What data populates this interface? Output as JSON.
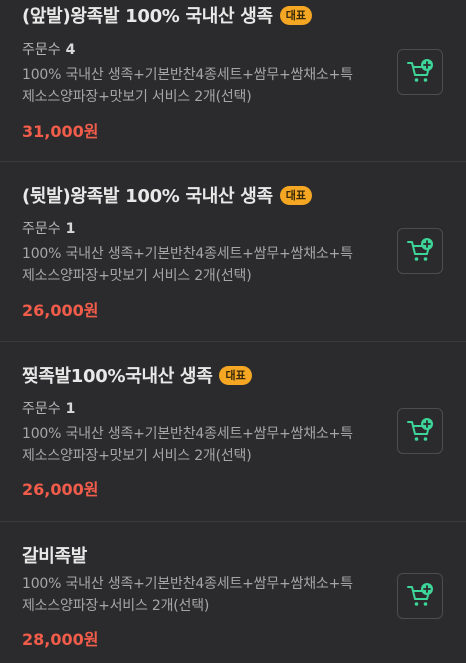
{
  "colors": {
    "background": "#2b2b2d",
    "price": "#f25c4a",
    "badge": "#f5a623",
    "cart_icon": "#3dd598"
  },
  "items": [
    {
      "name": "(앞발)왕족발 100% 국내산 생족",
      "badge": "대표",
      "order_label": "주문수",
      "order_count": "4",
      "desc_line1": "100% 국내산 생족+기본반찬4종세트+쌈무+쌈채소+특",
      "desc_line2": "제소스양파장+맛보기 서비스 2개(선택)",
      "price": "31,000원",
      "cart_icon": "cart-add-icon"
    },
    {
      "name": "(뒷발)왕족발 100% 국내산 생족",
      "badge": "대표",
      "order_label": "주문수",
      "order_count": "1",
      "desc_line1": "100% 국내산 생족+기본반찬4종세트+쌈무+쌈채소+특",
      "desc_line2": "제소스양파장+맛보기 서비스 2개(선택)",
      "price": "26,000원",
      "cart_icon": "cart-add-icon"
    },
    {
      "name": "찢족발100%국내산 생족",
      "badge": "대표",
      "order_label": "주문수",
      "order_count": "1",
      "desc_line1": "100% 국내산 생족+기본반찬4종세트+쌈무+쌈채소+특",
      "desc_line2": "제소스양파장+맛보기 서비스 2개(선택)",
      "price": "26,000원",
      "cart_icon": "cart-add-icon"
    },
    {
      "name": "갈비족발",
      "desc_line1": "100% 국내산 생족+기본반찬4종세트+쌈무+쌈채소+특",
      "desc_line2": "제소스양파장+서비스 2개(선택)",
      "price": "28,000원",
      "cart_icon": "cart-add-icon"
    }
  ]
}
